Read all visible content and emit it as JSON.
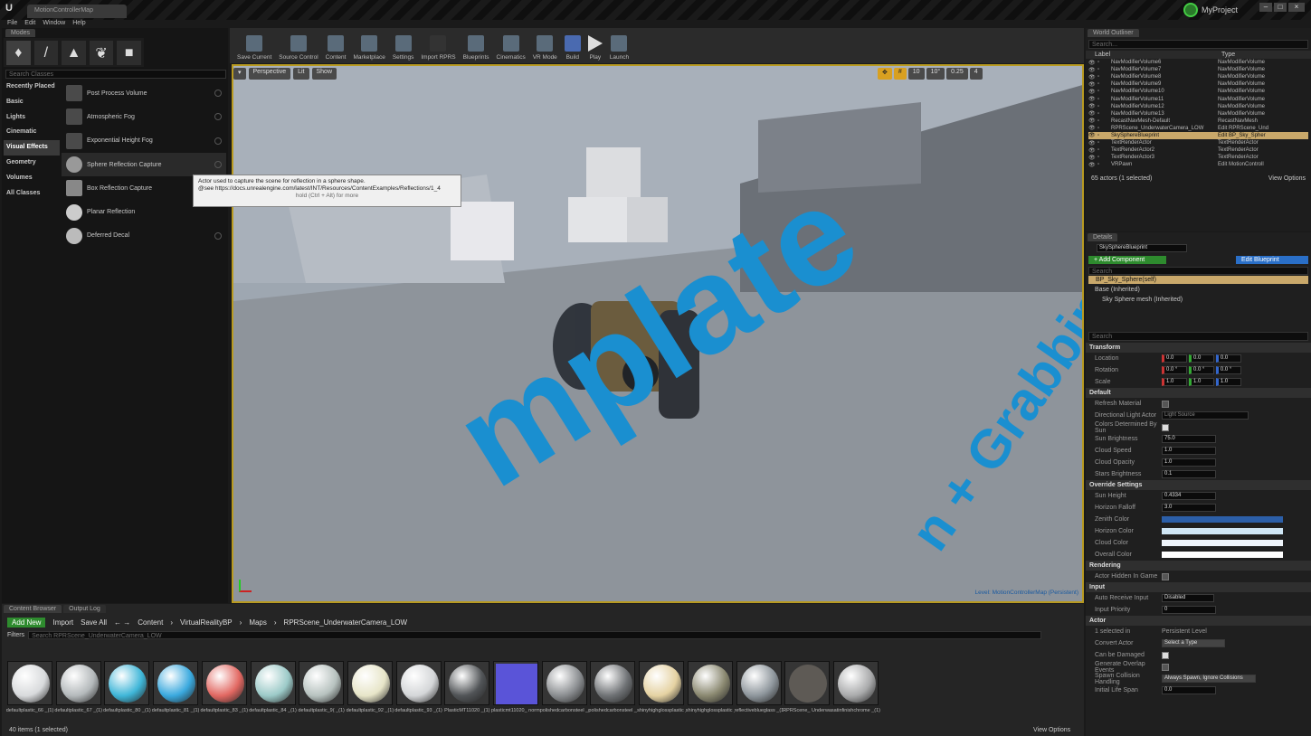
{
  "window": {
    "app_tab": "MotionControllerMap",
    "project": "MyProject"
  },
  "menu": [
    "File",
    "Edit",
    "Window",
    "Help"
  ],
  "modes": {
    "tab": "Modes",
    "search_placeholder": "Search Classes",
    "categories": [
      "Recently Placed",
      "Basic",
      "Lights",
      "Cinematic",
      "Visual Effects",
      "Geometry",
      "Volumes",
      "All Classes"
    ],
    "items": [
      "Post Process Volume",
      "Atmospheric Fog",
      "Exponential Height Fog",
      "Sphere Reflection Capture",
      "Box Reflection Capture",
      "Planar Reflection",
      "Deferred Decal"
    ]
  },
  "tooltip": {
    "line1": "Actor used to capture the scene for reflection in a sphere shape.",
    "line2": "@see https://docs.unrealengine.com/latest/INT/Resources/ContentExamples/Reflections/1_4",
    "hint": "hold (Ctrl + Alt) for more"
  },
  "toolbar": [
    "Save Current",
    "Source Control",
    "Content",
    "Marketplace",
    "Settings",
    "Import RPRS",
    "Blueprints",
    "Cinematics",
    "VR Mode",
    "Build",
    "Play",
    "Launch"
  ],
  "viewport": {
    "perspective": "Perspective",
    "lit": "Lit",
    "show": "Show",
    "grid": "10",
    "angle": "10°",
    "scale": "0.25",
    "cam": "4",
    "level": "Level: MotionControllerMap (Persistent)"
  },
  "outliner": {
    "tab": "World Outliner",
    "search_placeholder": "Search...",
    "col_label": "Label",
    "col_type": "Type",
    "rows": [
      [
        "NavModifierVolume6",
        "NavModifierVolume"
      ],
      [
        "NavModifierVolume7",
        "NavModifierVolume"
      ],
      [
        "NavModifierVolume8",
        "NavModifierVolume"
      ],
      [
        "NavModifierVolume9",
        "NavModifierVolume"
      ],
      [
        "NavModifierVolume10",
        "NavModifierVolume"
      ],
      [
        "NavModifierVolume11",
        "NavModifierVolume"
      ],
      [
        "NavModifierVolume12",
        "NavModifierVolume"
      ],
      [
        "NavModifierVolume13",
        "NavModifierVolume"
      ],
      [
        "RecastNavMesh-Default",
        "RecastNavMesh"
      ],
      [
        "RPRScene_UnderwaterCamera_LOW",
        "Edit RPRScene_Und"
      ],
      [
        "SkySphereBlueprint",
        "Edit BP_Sky_Spher"
      ],
      [
        "TextRenderActor",
        "TextRenderActor"
      ],
      [
        "TextRenderActor2",
        "TextRenderActor"
      ],
      [
        "TextRenderActor3",
        "TextRenderActor"
      ],
      [
        "VRPawn",
        "Edit MotionControll"
      ]
    ],
    "summary": "65 actors (1 selected)",
    "view_options": "View Options"
  },
  "details": {
    "tab": "Details",
    "name": "SkySphereBlueprint",
    "add_component": "+ Add Component",
    "edit_blueprint": "Edit Blueprint",
    "search": "Search",
    "self": "BP_Sky_Sphere(self)",
    "base": "Base (Inherited)",
    "mesh": "Sky Sphere mesh (Inherited)",
    "transform": "Transform",
    "location": "Location",
    "rotation": "Rotation",
    "scale": "Scale",
    "loc": [
      "0.0",
      "0.0",
      "0.0"
    ],
    "rot": [
      "0.0 °",
      "0.0 °",
      "0.0 °"
    ],
    "scl": [
      "1.0",
      "1.0",
      "1.0"
    ],
    "default": "Default",
    "refresh": "Refresh Material",
    "dir_light": "Directional Light Actor",
    "light_source": "Light Source",
    "colors_by": "Colors Determined By Sun",
    "sun_bright": "Sun Brightness",
    "sun_bright_v": "75.0",
    "cloud_speed": "Cloud Speed",
    "cloud_speed_v": "1.0",
    "cloud_opacity": "Cloud Opacity",
    "cloud_opacity_v": "1.0",
    "stars": "Stars Brightness",
    "stars_v": "0.1",
    "override": "Override Settings",
    "sun_height": "Sun Height",
    "sun_height_v": "0.4334",
    "horizon_falloff": "Horizon Falloff",
    "horizon_falloff_v": "3.0",
    "zenith": "Zenith Color",
    "horizon": "Horizon Color",
    "cloud_color": "Cloud Color",
    "overall": "Overall Color",
    "rendering": "Rendering",
    "hidden": "Actor Hidden In Game",
    "input": "Input",
    "auto_recv": "Auto Receive Input",
    "disabled": "Disabled",
    "input_pri": "Input Priority",
    "input_pri_v": "0",
    "actor": "Actor",
    "selected_in": "1 selected in",
    "persistent": "Persistent Level",
    "convert": "Convert Actor",
    "select_type": "Select a Type",
    "damaged": "Can be Damaged",
    "overlap": "Generate Overlap Events",
    "spawn": "Spawn Collision Handling",
    "spawn_v": "Always Spawn, Ignore Collisions",
    "lifespan": "Initial Life Span",
    "lifespan_v": "0.0"
  },
  "content": {
    "tab1": "Content Browser",
    "tab2": "Output Log",
    "add_new": "Add New",
    "import": "Import",
    "save_all": "Save All",
    "path": [
      "Content",
      "VirtualRealityBP",
      "Maps",
      "RPRScene_UnderwaterCamera_LOW"
    ],
    "filters": "Filters",
    "search": "Search RPRScene_UnderwaterCamera_LOW",
    "count": "40 items (1 selected)",
    "view_options": "View Options",
    "assets": [
      "defaultplastic_66 _(1)",
      "defaultplastic_67 _(1)",
      "defaultplastic_80 _(1)",
      "defaultplastic_81 _(1)",
      "defaultplastic_83 _(1)",
      "defaultplastic_84 _(1)",
      "defaultplastic_9( _(1)",
      "defaultplastic_92 _(1)",
      "defaultplastic_93 _(1)",
      "PlasticMT11020 _(1)",
      "plasticmt11020_ normalmap_dds",
      "polishedcarbonsteel _(1)",
      "polishedcarbonsteel _2(1)",
      "shinyhighglossplastic _(1)",
      "shinyhighglossplastic _2(1)",
      "reflectiveblueglass _(1)",
      "RPRScene_ Underwater Camera_LOW",
      "satinfinishchrome _(1)"
    ]
  }
}
